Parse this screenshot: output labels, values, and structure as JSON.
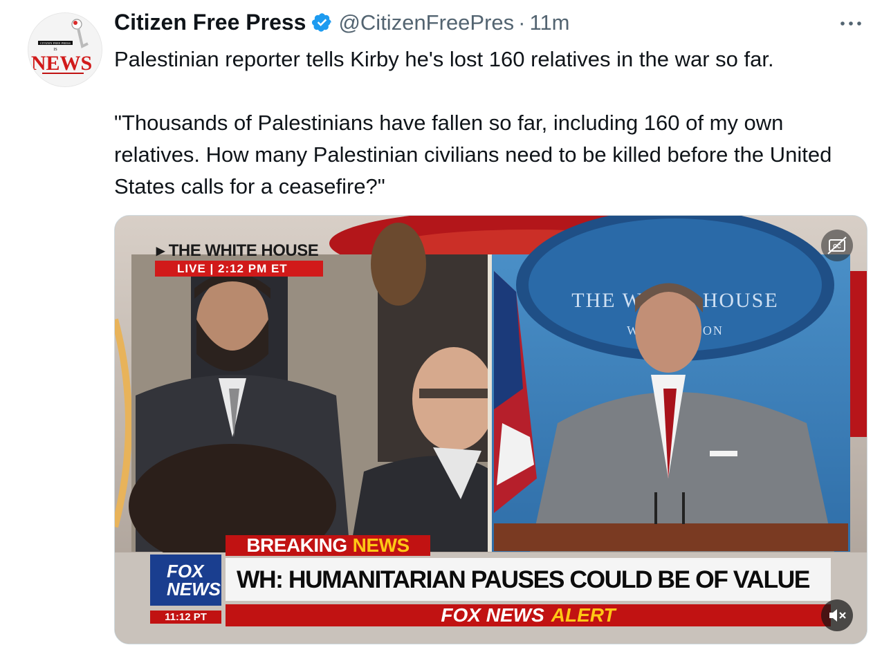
{
  "tweet": {
    "author_name": "Citizen Free Press",
    "handle": "@CitizenFreePres",
    "separator": "·",
    "time": "11m",
    "paragraphs": [
      "Palestinian reporter tells Kirby he's lost 160 relatives in the war so far.",
      "\"Thousands of Palestinians have fallen so far, including 160 of my own relatives. How many Palestinian civilians need to be killed before the United States calls for a ceasefire?\""
    ]
  },
  "avatar": {
    "small_text": "CITIZEN FREE PRESS",
    "is_text": "IS",
    "news_text": "NEWS"
  },
  "video": {
    "location_label": "THE WHITE HOUSE",
    "live_label": "LIVE  |  2:12 PM ET",
    "backdrop_text": "THE WHITE HOUSE",
    "backdrop_subtext": "WASHINGTON",
    "breaking": "BREAKING",
    "breaking_news": "NEWS",
    "headline": "WH: HUMANITARIAN PAUSES COULD BE OF VALUE",
    "alert_prefix": "FOX NEWS",
    "alert_word": "ALERT",
    "fox_logo_line1": "FOX",
    "fox_logo_line2": "NEWS",
    "fox_time": "11:12 PT"
  },
  "colors": {
    "verified_blue": "#1d9bf0",
    "secondary_text": "#536471",
    "fox_red": "#c11212",
    "fox_yellow": "#ffc815",
    "fox_blue": "#1a3e8f"
  },
  "icons": [
    "verified-badge-icon",
    "more-options-icon",
    "closed-captions-icon",
    "mute-icon"
  ]
}
